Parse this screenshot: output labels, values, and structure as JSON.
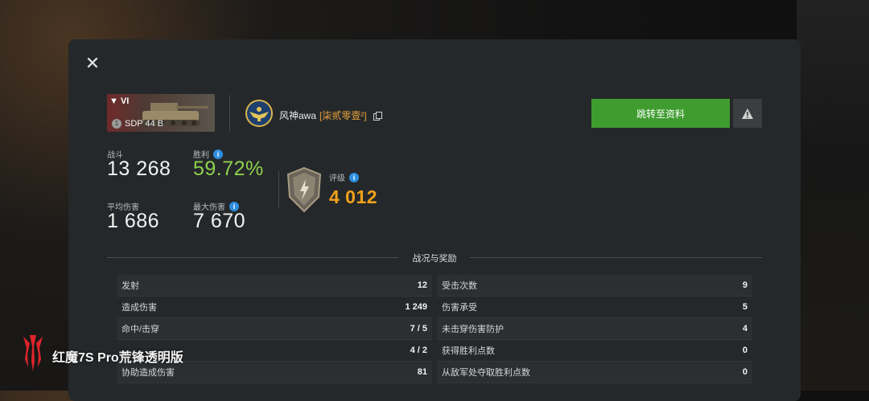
{
  "header": {
    "close_icon": "close-icon",
    "tank": {
      "tier": "VI",
      "name": "SDP 44 B",
      "mastery": "1"
    },
    "player": {
      "name": "风神awa",
      "clan": "[柒贰零壹²]"
    },
    "goto_label": "跳转至资料",
    "report_icon": "warning-icon"
  },
  "stats": {
    "battles": {
      "label": "战斗",
      "value": "13 268"
    },
    "winrate": {
      "label": "胜利",
      "value": "59.72%"
    },
    "avg_damage": {
      "label": "平均伤害",
      "value": "1 686"
    },
    "max_damage": {
      "label": "最大伤害",
      "value": "7 670"
    },
    "rating": {
      "label": "评级",
      "value": "4 012"
    }
  },
  "section": {
    "title": "战况与奖励",
    "left": [
      {
        "label": "发射",
        "value": "12"
      },
      {
        "label": "造成伤害",
        "value": "1 249"
      },
      {
        "label": "命中/击穿",
        "value": "7 / 5"
      },
      {
        "label": "",
        "value": "4 / 2"
      },
      {
        "label": "协助造成伤害",
        "value": "81"
      }
    ],
    "right": [
      {
        "label": "受击次数",
        "value": "9"
      },
      {
        "label": "伤害承受",
        "value": "5"
      },
      {
        "label": "未击穿伤害防护",
        "value": "4"
      },
      {
        "label": "获得胜利点数",
        "value": "0"
      },
      {
        "label": "从敌军处夺取胜利点数",
        "value": "0"
      }
    ]
  },
  "watermark": {
    "text": "红魔7S Pro荒锋透明版"
  },
  "colors": {
    "accent_green": "#3f9d2f",
    "winrate_green": "#8ed14e",
    "rating_orange": "#f0a11c",
    "info_blue": "#2d8ee0"
  }
}
